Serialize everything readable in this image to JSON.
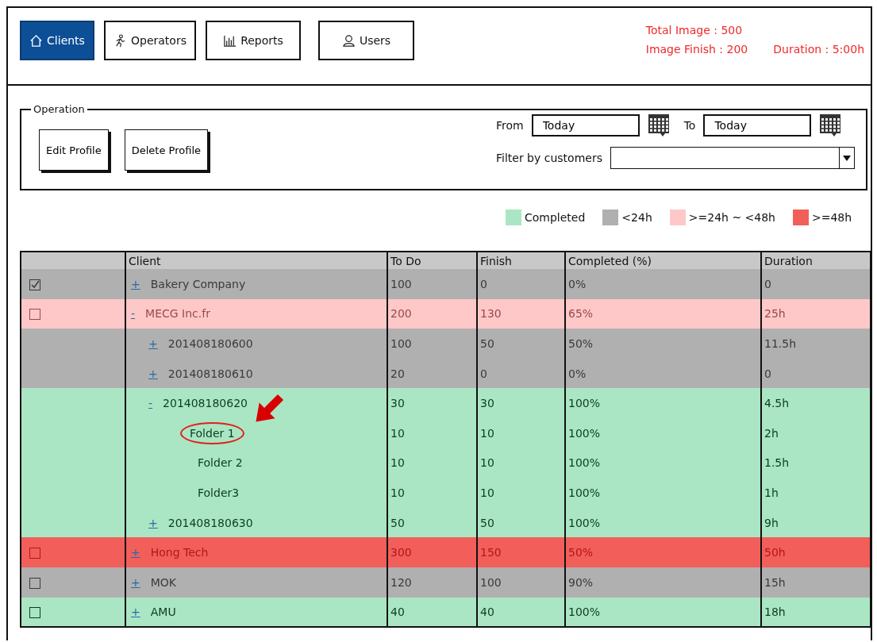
{
  "tabs": [
    {
      "label": "Clients",
      "kind": "home",
      "selected": true
    },
    {
      "label": "Operators",
      "kind": "operator",
      "selected": false
    },
    {
      "label": "Reports",
      "kind": "chart",
      "selected": false
    },
    {
      "label": "Users",
      "kind": "user",
      "selected": false
    }
  ],
  "stats": [
    {
      "label": "Total Image : 500"
    },
    {
      "label": "Image Finish : 200"
    },
    {
      "label": "Duration : 5:00h"
    }
  ],
  "operation": {
    "title": "Operation",
    "buttons": [
      "Edit Profile",
      "Delete Profile"
    ],
    "from_label": "From",
    "from_value": "Today",
    "to_label": "To",
    "to_value": "Today",
    "filter_label": "Filter by customers"
  },
  "legend": [
    {
      "label": "Completed",
      "color": "#aae6c3"
    },
    {
      "label": "<24h",
      "color": "#b0b0b0"
    },
    {
      "label": ">=24h ~ <48h",
      "color": "#ffc8c8"
    },
    {
      "label": ">=48h",
      "color": "#f25e5a"
    }
  ],
  "table": {
    "columns": [
      "Client",
      "To Do",
      "Finish",
      "Completed (%)",
      "Duration"
    ],
    "rows": [
      {
        "toggle": "+",
        "name": "Bakery Company",
        "todo": "100",
        "finish": "0",
        "completed": "0%",
        "duration": "0",
        "color": "#b0b0b0",
        "checked": true
      },
      {
        "toggle": "-",
        "name": "MECG Inc.fr",
        "todo": "200",
        "finish": "130",
        "completed": "65%",
        "duration": "25h",
        "color": "#ffc8c8",
        "checked": false,
        "children": [
          {
            "toggle": "+",
            "name": "201408180600",
            "todo": "100",
            "finish": "50",
            "completed": "50%",
            "duration": "11.5h",
            "color": "#b0b0b0"
          },
          {
            "toggle": "+",
            "name": "201408180610",
            "todo": "20",
            "finish": "0",
            "completed": "0%",
            "duration": "0",
            "color": "#b0b0b0"
          },
          {
            "toggle": "-",
            "name": "201408180620",
            "todo": "30",
            "finish": "30",
            "completed": "100%",
            "duration": "4.5h",
            "color": "#aae6c3",
            "children": [
              {
                "name": "Folder 1",
                "todo": "10",
                "finish": "10",
                "completed": "100%",
                "duration": "2h",
                "color": "#aae6c3",
                "highlighted": true
              },
              {
                "name": "Folder 2",
                "todo": "10",
                "finish": "10",
                "completed": "100%",
                "duration": "1.5h",
                "color": "#aae6c3",
                "highlighted": false
              },
              {
                "name": "Folder3",
                "todo": "10",
                "finish": "10",
                "completed": "100%",
                "duration": "1h",
                "color": "#aae6c3",
                "highlighted": false
              }
            ]
          },
          {
            "toggle": "+",
            "name": "201408180630",
            "todo": "50",
            "finish": "50",
            "completed": "100%",
            "duration": "9h",
            "color": "#aae6c3"
          }
        ]
      },
      {
        "toggle": "+",
        "name": "Hong Tech",
        "todo": "300",
        "finish": "150",
        "completed": "50%",
        "duration": "50h",
        "color": "#f25e5a",
        "checked": false
      },
      {
        "toggle": "+",
        "name": "MOK",
        "todo": "120",
        "finish": "100",
        "completed": "90%",
        "duration": "15h",
        "color": "#b0b0b0",
        "checked": false
      },
      {
        "toggle": "+",
        "name": "AMU",
        "todo": "40",
        "finish": "40",
        "completed": "100%",
        "duration": "18h",
        "color": "#aae6c3",
        "checked": false
      }
    ]
  }
}
